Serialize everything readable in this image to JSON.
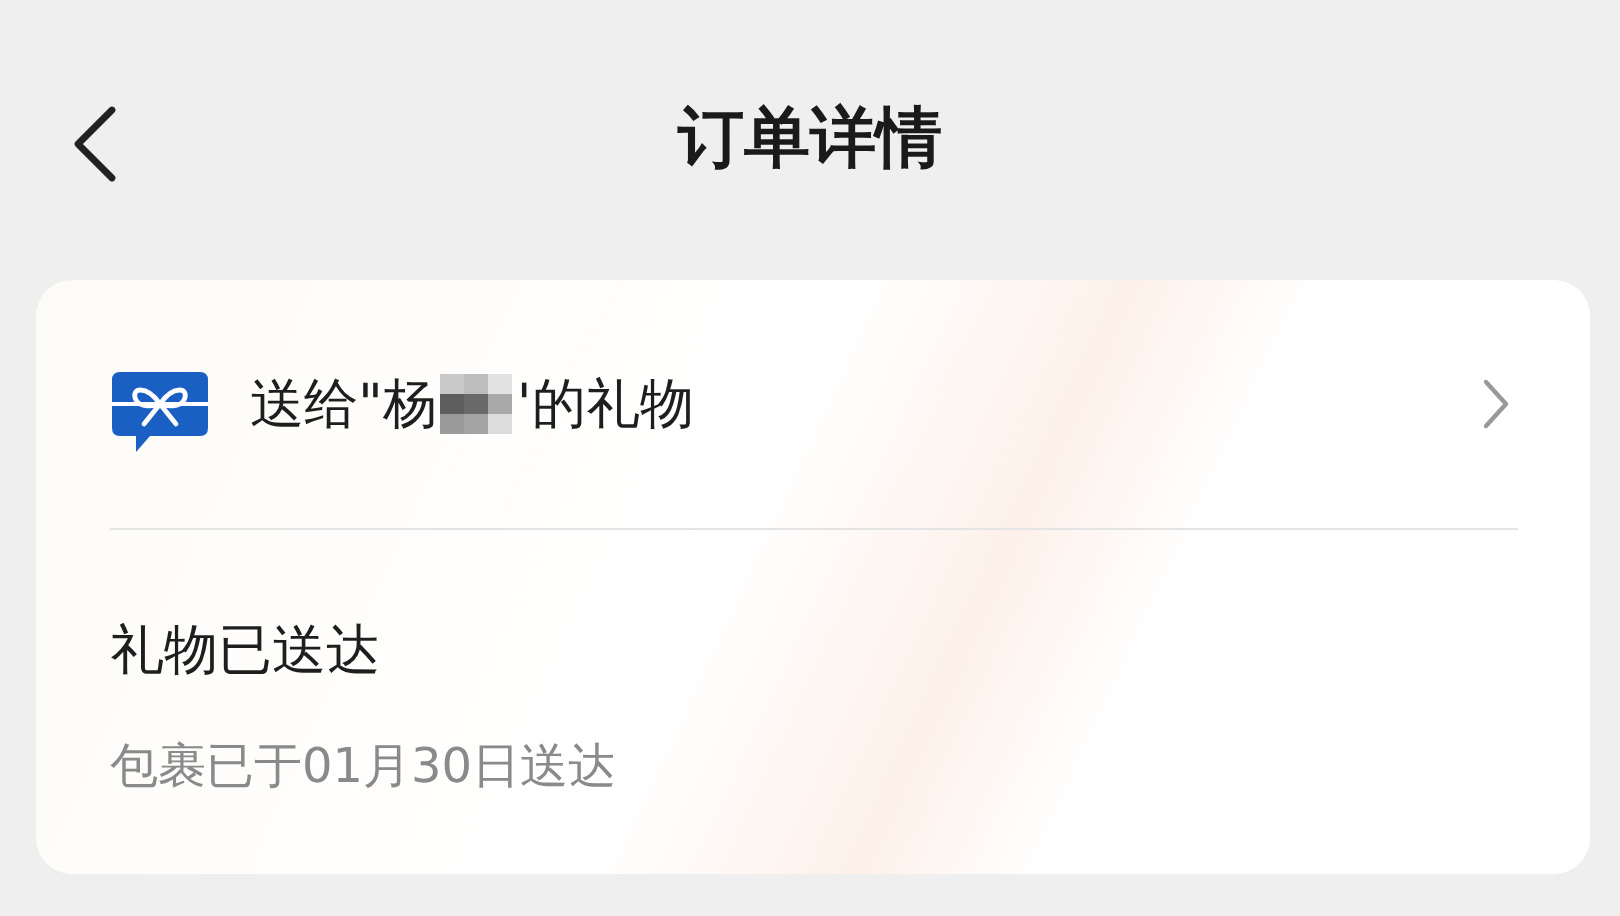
{
  "header": {
    "title": "订单详情"
  },
  "gift": {
    "title_start": "送给\"杨",
    "title_end": "'的礼物"
  },
  "delivery": {
    "status": "礼物已送达",
    "detail": "包裹已于01月30日送达"
  }
}
